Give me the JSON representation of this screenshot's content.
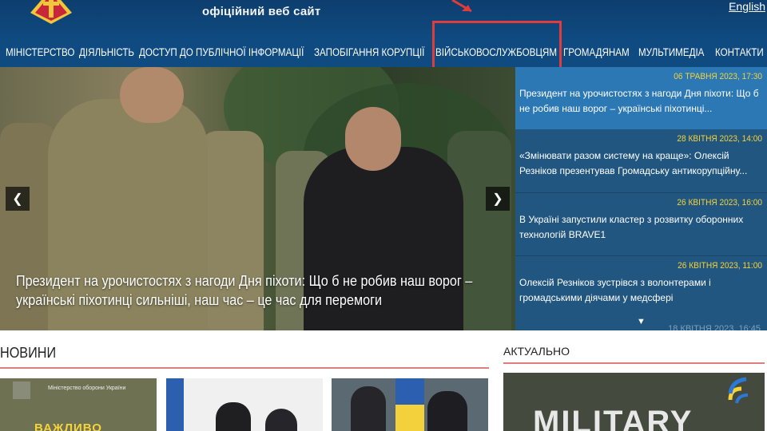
{
  "header": {
    "subtitle": "офіційний веб сайт",
    "lang_link": "English"
  },
  "nav": {
    "items": [
      "МІНІСТЕРСТВО",
      "ДІЯЛЬНІСТЬ",
      "ДОСТУП ДО ПУБЛІЧНОЇ ІНФОРМАЦІЇ",
      "ЗАПОБІГАННЯ КОРУПЦІЇ",
      "ВІЙСЬКОВОСЛУЖБОВЦЯМ",
      "ГРОМАДЯНАМ",
      "МУЛЬТИМЕДІА",
      "КОНТАКТИ"
    ]
  },
  "hero": {
    "caption": "Президент на урочистостях з нагоди Дня піхоти: Що б не робив наш ворог – українські піхотинці сильніші, наш час – це час для перемоги",
    "prev_icon": "chevron-left-icon",
    "next_icon": "chevron-right-icon"
  },
  "side_news": [
    {
      "date": "06 ТРАВНЯ 2023, 17:30",
      "title": "Президент на урочистостях з нагоди Дня піхоти: Що б не робив наш ворог – українські піхотинці..."
    },
    {
      "date": "28 КВІТНЯ 2023, 14:00",
      "title": "«Змінювати разом систему на краще»: Олексій Резніков презентував Громадську антикорупційну..."
    },
    {
      "date": "26 КВІТНЯ 2023, 16:00",
      "title": "В Україні запустили кластер з розвитку оборонних технологій BRAVE1"
    },
    {
      "date": "26 КВІТНЯ 2023, 11:00",
      "title": "Олексій Резніков зустрівся з волонтерами і громадськими діячами у медсфері"
    }
  ],
  "side_more_icon": "triangle-down-icon",
  "side_ghost_date": "18 КВІТНЯ 2023, 16:45",
  "sections": {
    "news": "НОВИНИ",
    "actual": "АКТУАЛЬНО"
  },
  "cards": {
    "card1_org": "Міністерство оборони України",
    "card1_warn": "ВАЖЛИВО"
  },
  "banner": {
    "text": "MILITARY"
  },
  "colors": {
    "nav_bg": "#0f4a80",
    "side_bg": "#215680",
    "side_active": "#2b78b4",
    "date_yellow": "#f5d33a",
    "highlight": "#e23b3b"
  }
}
